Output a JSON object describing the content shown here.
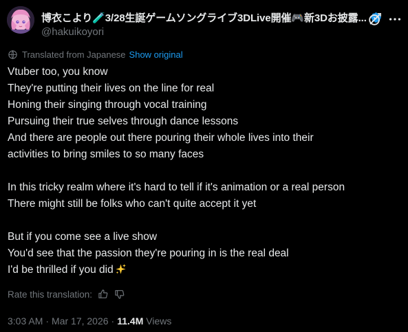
{
  "author": {
    "display_name": "博衣こより🧪3/28生誕ゲームソングライブ3DLive開催🎮新3Dお披露...",
    "handle": "@hakuikoyori",
    "verified": true
  },
  "translation": {
    "label": "Translated from Japanese",
    "show_original": "Show original"
  },
  "tweet": {
    "lines": [
      "Vtuber too, you know",
      "They're putting their lives on the line for real",
      "Honing their singing through vocal training",
      "Pursuing their true selves through dance lessons",
      "And there are people out there pouring their whole lives into their",
      "activities to bring smiles to so many faces",
      "",
      "In this tricky realm where it's hard to tell if it's animation or a real person",
      "There might still be folks who can't quite accept it yet",
      "",
      "But if you come see a live show",
      "You'd see that the passion they're pouring in is the real deal",
      "I'd be thrilled if you did"
    ]
  },
  "rate": {
    "label": "Rate this translation:"
  },
  "meta": {
    "time": "3:03 AM",
    "date": "Mar 17, 2026",
    "views_count": "11.4M",
    "views_label": "Views"
  },
  "icons": {
    "verified": "verified-badge-icon",
    "grok": "grok-icon",
    "more": "more-icon",
    "translate": "translate-icon",
    "sparkle": "sparkles-icon",
    "thumb_up": "thumbs-up-icon",
    "thumb_down": "thumbs-down-icon"
  },
  "colors": {
    "background": "#000000",
    "text": "#e7e9ea",
    "muted": "#71767b",
    "accent": "#1d9bf0"
  }
}
